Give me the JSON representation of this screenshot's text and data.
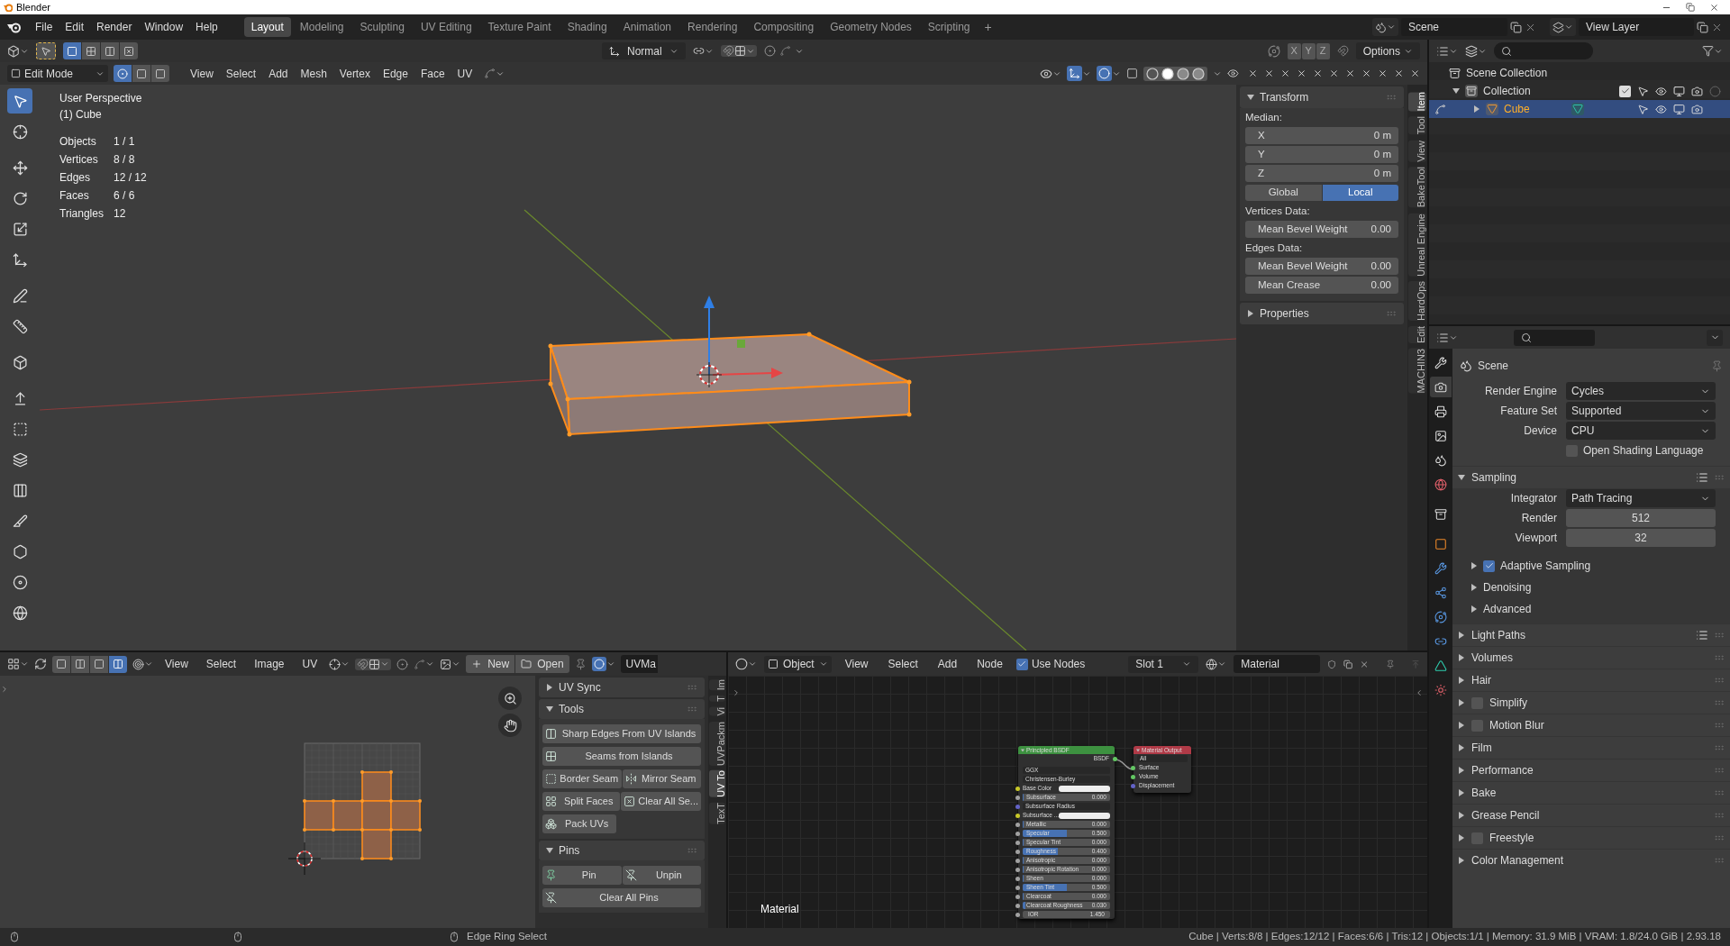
{
  "window": {
    "title": "Blender"
  },
  "menu": [
    "File",
    "Edit",
    "Render",
    "Window",
    "Help"
  ],
  "workspaces": [
    {
      "label": "Layout",
      "selected": true
    },
    {
      "label": "Modeling",
      "selected": false
    },
    {
      "label": "Sculpting",
      "selected": false
    },
    {
      "label": "UV Editing",
      "selected": false
    },
    {
      "label": "Texture Paint",
      "selected": false
    },
    {
      "label": "Shading",
      "selected": false
    },
    {
      "label": "Animation",
      "selected": false
    },
    {
      "label": "Rendering",
      "selected": false
    },
    {
      "label": "Compositing",
      "selected": false
    },
    {
      "label": "Geometry Nodes",
      "selected": false
    },
    {
      "label": "Scripting",
      "selected": false
    }
  ],
  "add_workspace": "+",
  "scene": {
    "name": "Scene"
  },
  "view_layer": {
    "name": "View Layer"
  },
  "viewport": {
    "header": {
      "set_modes": [
        {
          "selected": true
        },
        {
          "selected": false
        },
        {
          "selected": false
        },
        {
          "selected": false
        }
      ],
      "orientation": "Normal",
      "axes": [
        "X",
        "Y",
        "Z"
      ],
      "options": "Options",
      "mode": "Edit Mode",
      "select_modes": [
        {
          "selected": true
        },
        {
          "selected": false
        },
        {
          "selected": false
        }
      ],
      "menus": [
        "View",
        "Select",
        "Add",
        "Mesh",
        "Vertex",
        "Edge",
        "Face",
        "UV"
      ],
      "shading": [
        {
          "selected": false
        },
        {
          "selected": true
        },
        {
          "selected": false
        },
        {
          "selected": false
        }
      ]
    },
    "toolbar": [
      {
        "selected": true
      },
      {
        "selected": false
      },
      {
        "selected": false
      },
      {
        "selected": false
      },
      {
        "selected": false
      },
      {
        "selected": false
      },
      {
        "selected": false
      },
      {
        "selected": false
      },
      {
        "selected": false
      },
      {
        "selected": false
      },
      {
        "selected": false
      },
      {
        "selected": false
      },
      {
        "selected": false
      },
      {
        "selected": false
      },
      {
        "selected": false
      },
      {
        "selected": false
      },
      {
        "selected": false
      }
    ],
    "info": {
      "view": "User Perspective",
      "object": "(1) Cube",
      "stats": [
        {
          "label": "Objects",
          "value": "1 / 1"
        },
        {
          "label": "Vertices",
          "value": "8 / 8"
        },
        {
          "label": "Edges",
          "value": "12 / 12"
        },
        {
          "label": "Faces",
          "value": "6 / 6"
        },
        {
          "label": "Triangles",
          "value": "12"
        }
      ]
    },
    "sidebar": {
      "panels": [
        {
          "title": "Transform",
          "expanded": true,
          "rows": [
            {
              "kind": "heading",
              "label": "Median:"
            },
            {
              "kind": "field",
              "label": "X",
              "value": "0 m"
            },
            {
              "kind": "field",
              "label": "Y",
              "value": "0 m"
            },
            {
              "kind": "field",
              "label": "Z",
              "value": "0 m"
            },
            {
              "kind": "toggle",
              "options": [
                {
                  "label": "Global",
                  "selected": false
                },
                {
                  "label": "Local",
                  "selected": true
                }
              ]
            },
            {
              "kind": "heading",
              "label": "Vertices Data:"
            },
            {
              "kind": "field",
              "label": "Mean Bevel Weight",
              "value": "0.00"
            },
            {
              "kind": "heading",
              "label": "Edges Data:"
            },
            {
              "kind": "field",
              "label": "Mean Bevel Weight",
              "value": "0.00"
            },
            {
              "kind": "field",
              "label": "Mean Crease",
              "value": "0.00"
            }
          ]
        },
        {
          "title": "Properties",
          "expanded": false
        }
      ],
      "tabs": [
        {
          "label": "Item",
          "selected": true
        },
        {
          "label": "Tool",
          "selected": false
        },
        {
          "label": "View",
          "selected": false
        },
        {
          "label": "BakeTool",
          "selected": false
        },
        {
          "label": "Unreal Engine",
          "selected": false
        },
        {
          "label": "HardOps",
          "selected": false
        },
        {
          "label": "Edit",
          "selected": false
        },
        {
          "label": "MACHIN3",
          "selected": false
        }
      ]
    }
  },
  "outliner": {
    "scene_collection": {
      "label": "Scene Collection",
      "collections": [
        {
          "label": "Collection",
          "expanded": true,
          "checked": true,
          "selected": false,
          "objects": [
            {
              "label": "Cube",
              "expanded": false,
              "selected": true
            }
          ]
        }
      ]
    }
  },
  "properties": {
    "tabs": [
      {
        "selected": false
      },
      {
        "selected": true
      },
      {
        "selected": false
      },
      {
        "selected": false
      },
      {
        "selected": false
      },
      {
        "selected": false
      },
      {
        "selected": false
      },
      {
        "selected": false
      },
      {
        "selected": false
      },
      {
        "selected": false
      },
      {
        "selected": false
      },
      {
        "selected": false
      },
      {
        "selected": false
      },
      {
        "selected": false
      }
    ],
    "context": "Scene",
    "rows": [
      {
        "kind": "dropdown",
        "label": "Render Engine",
        "value": "Cycles"
      },
      {
        "kind": "dropdown",
        "label": "Feature Set",
        "value": "Supported"
      },
      {
        "kind": "dropdown",
        "label": "Device",
        "value": "CPU"
      },
      {
        "kind": "checkbox",
        "label": "Open Shading Language",
        "checked": false
      }
    ],
    "panels": [
      {
        "title": "Sampling",
        "kind": "plain",
        "expanded": true,
        "presets": true,
        "rows": [
          {
            "kind": "dropdown",
            "label": "Integrator",
            "value": "Path Tracing"
          },
          {
            "kind": "number",
            "label": "Render",
            "value": "512"
          },
          {
            "kind": "number",
            "label": "Viewport",
            "value": "32"
          }
        ],
        "subpanels": [
          {
            "title": "Adaptive Sampling",
            "kind": "check",
            "checked": true,
            "expanded": false
          },
          {
            "title": "Denoising",
            "kind": "plain",
            "expanded": false
          },
          {
            "title": "Advanced",
            "kind": "plain",
            "expanded": false
          }
        ]
      },
      {
        "title": "Light Paths",
        "kind": "plain",
        "expanded": false,
        "presets": true
      },
      {
        "title": "Volumes",
        "kind": "plain",
        "expanded": false,
        "presets": false
      },
      {
        "title": "Hair",
        "kind": "plain",
        "expanded": false,
        "presets": false
      },
      {
        "title": "Simplify",
        "kind": "check",
        "checked": false,
        "expanded": false,
        "presets": false
      },
      {
        "title": "Motion Blur",
        "kind": "check",
        "checked": false,
        "expanded": false,
        "presets": false
      },
      {
        "title": "Film",
        "kind": "plain",
        "expanded": false,
        "presets": false
      },
      {
        "title": "Performance",
        "kind": "plain",
        "expanded": false,
        "presets": false
      },
      {
        "title": "Bake",
        "kind": "plain",
        "expanded": false,
        "presets": false
      },
      {
        "title": "Grease Pencil",
        "kind": "plain",
        "expanded": false,
        "presets": false
      },
      {
        "title": "Freestyle",
        "kind": "check",
        "checked": false,
        "expanded": false,
        "presets": false
      },
      {
        "title": "Color Management",
        "kind": "plain",
        "expanded": false,
        "presets": false
      }
    ]
  },
  "uv_editor": {
    "header": {
      "select_modes": [
        {
          "selected": false
        },
        {
          "selected": false
        },
        {
          "selected": false
        },
        {
          "selected": true
        }
      ],
      "menus": [
        "View",
        "Select",
        "Image",
        "UV"
      ],
      "new": "New",
      "open": "Open",
      "uv_map": "UVMa"
    },
    "sidebar": {
      "panels": [
        {
          "title": "UV Sync",
          "expanded": false
        },
        {
          "title": "Tools",
          "expanded": true,
          "buttons": [
            [
              "Sharp Edges From UV Islands"
            ],
            [
              "Seams from Islands"
            ],
            [
              "Border Seam",
              "Mirror Seam"
            ],
            [
              "Split Faces",
              "Clear All Se..."
            ],
            [
              "Pack UVs"
            ]
          ]
        },
        {
          "title": "Pins",
          "expanded": true,
          "buttons": [
            [
              "Pin",
              "Unpin"
            ],
            [
              "Clear All Pins"
            ]
          ]
        }
      ],
      "tabs": [
        {
          "label": "Im",
          "selected": false
        },
        {
          "label": "T",
          "selected": false
        },
        {
          "label": "Vi",
          "selected": false
        },
        {
          "label": "UVPackm",
          "selected": false
        },
        {
          "label": "UV To",
          "selected": true
        },
        {
          "label": "TexT",
          "selected": false
        }
      ]
    }
  },
  "node_editor": {
    "header": {
      "type": "Object",
      "menus": [
        "View",
        "Select",
        "Add",
        "Node"
      ],
      "use_nodes": {
        "label": "Use Nodes",
        "checked": true
      },
      "slot": "Slot 1",
      "material": "Material"
    },
    "label": "Material",
    "nodes": [
      {
        "kind": "bsdf",
        "title": "Principled BSDF",
        "output": "BSDF",
        "rows": [
          {
            "kind": "dropdown",
            "label": "GGX"
          },
          {
            "kind": "dropdown",
            "label": "Christensen-Burley"
          },
          {
            "kind": "color",
            "label": "Base Color",
            "color": "#c7c729"
          },
          {
            "kind": "slider",
            "label": "Subsurface",
            "value": "0.000",
            "level": 0,
            "color": "#a1a1a1"
          },
          {
            "kind": "dropdown",
            "label": "Subsurface Radius",
            "color": "#6363c7"
          },
          {
            "kind": "color",
            "label": "Subsurface ...",
            "color": "#c7c729"
          },
          {
            "kind": "slider",
            "label": "Metallic",
            "value": "0.000",
            "level": 0,
            "color": "#a1a1a1"
          },
          {
            "kind": "slider",
            "label": "Specular",
            "value": "0.500",
            "level": 0.5,
            "color": "#a1a1a1"
          },
          {
            "kind": "slider",
            "label": "Specular Tint",
            "value": "0.000",
            "level": 0,
            "color": "#a1a1a1"
          },
          {
            "kind": "slider",
            "label": "Roughness",
            "value": "0.400",
            "level": 0.4,
            "color": "#a1a1a1"
          },
          {
            "kind": "slider",
            "label": "Anisotropic",
            "value": "0.000",
            "level": 0,
            "color": "#a1a1a1"
          },
          {
            "kind": "slider",
            "label": "Anisotropic Rotation",
            "value": "0.000",
            "level": 0,
            "color": "#a1a1a1"
          },
          {
            "kind": "slider",
            "label": "Sheen",
            "value": "0.000",
            "level": 0,
            "color": "#a1a1a1"
          },
          {
            "kind": "slider",
            "label": "Sheen Tint",
            "value": "0.500",
            "level": 0.5,
            "color": "#a1a1a1"
          },
          {
            "kind": "slider",
            "label": "Clearcoat",
            "value": "0.000",
            "level": 0,
            "color": "#a1a1a1"
          },
          {
            "kind": "slider",
            "label": "Clearcoat Roughness",
            "value": "0.030",
            "level": 0.03,
            "color": "#a1a1a1"
          },
          {
            "kind": "number",
            "label": "IOR",
            "value": "1.450",
            "color": "#a1a1a1"
          }
        ]
      },
      {
        "kind": "output",
        "title": "Material Output",
        "target": "All",
        "inputs": [
          {
            "label": "Surface",
            "color": "#63c763"
          },
          {
            "label": "Volume",
            "color": "#63c763"
          },
          {
            "label": "Displacement",
            "color": "#6363c7"
          }
        ]
      }
    ]
  },
  "status_bar": {
    "hint": "Edge Ring Select",
    "stats": "Cube | Verts:8/8 | Edges:12/12 | Faces:6/6 | Tris:12 | Objects:1/1 | Memory: 31.9 MiB | VRAM: 1.8/24.0 GiB | 2.93.18"
  }
}
